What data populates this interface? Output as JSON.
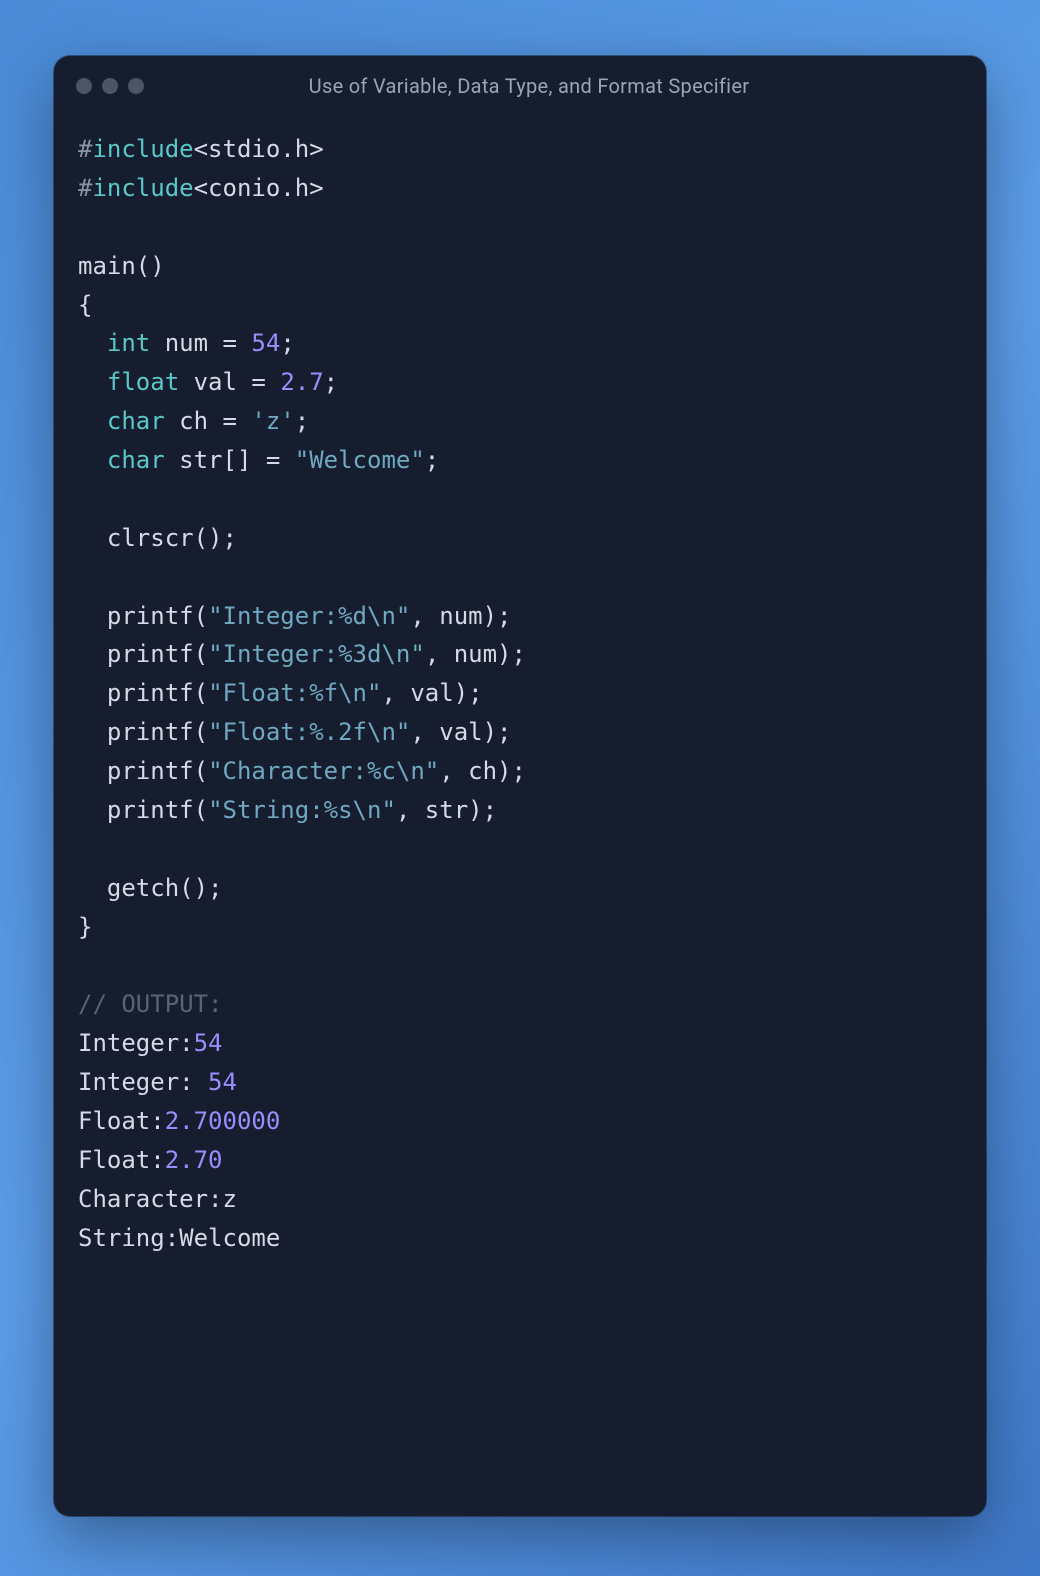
{
  "window": {
    "title": "Use of Variable, Data Type, and Format Specifier"
  },
  "code": {
    "include1_hash": "#",
    "include1_kw": "include",
    "include1_hdr": "<stdio.h>",
    "include2_hash": "#",
    "include2_kw": "include",
    "include2_hdr": "<conio.h>",
    "main_name": "main",
    "main_parens": "()",
    "brace_open": "{",
    "decl_int_kw": "int",
    "decl_int_rest_a": " num = ",
    "decl_int_num": "54",
    "decl_int_semi": ";",
    "decl_float_kw": "float",
    "decl_float_rest_a": " val = ",
    "decl_float_num": "2.7",
    "decl_float_semi": ";",
    "decl_char_kw": "char",
    "decl_char_rest_a": " ch = ",
    "decl_char_lit": "'z'",
    "decl_char_semi": ";",
    "decl_str_kw": "char",
    "decl_str_rest_a": " str[] = ",
    "decl_str_lit": "\"Welcome\"",
    "decl_str_semi": ";",
    "clrscr": "clrscr();",
    "printf1_a": "printf(",
    "printf1_str": "\"Integer:%d\\n\"",
    "printf1_b": ", num);",
    "printf2_a": "printf(",
    "printf2_str": "\"Integer:%3d\\n\"",
    "printf2_b": ", num);",
    "printf3_a": "printf(",
    "printf3_str": "\"Float:%f\\n\"",
    "printf3_b": ", val);",
    "printf4_a": "printf(",
    "printf4_str": "\"Float:%.2f\\n\"",
    "printf4_b": ", val);",
    "printf5_a": "printf(",
    "printf5_str": "\"Character:%c\\n\"",
    "printf5_b": ", ch);",
    "printf6_a": "printf(",
    "printf6_str": "\"String:%s\\n\"",
    "printf6_b": ", str);",
    "getch": "getch();",
    "brace_close": "}",
    "out_comment": "// OUTPUT:",
    "out1_a": "Integer:",
    "out1_b": "54",
    "out2_a": "Integer: ",
    "out2_b": "54",
    "out3_a": "Float:",
    "out3_b": "2.700000",
    "out4_a": "Float:",
    "out4_b": "2.70",
    "out5": "Character:z",
    "out6": "String:Welcome"
  }
}
